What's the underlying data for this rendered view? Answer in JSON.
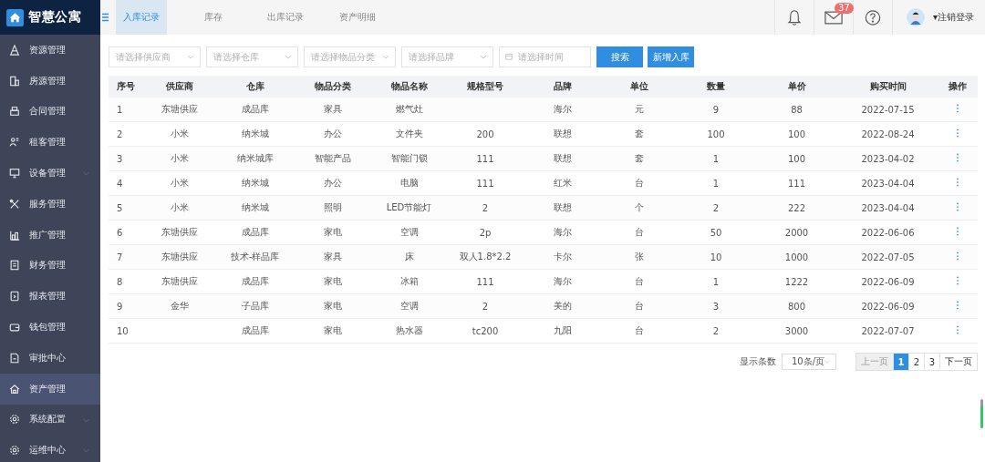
{
  "brand": "智慧公寓",
  "sidebar": {
    "items": [
      {
        "label": "资源管理",
        "selected": false,
        "has_submenu": false
      },
      {
        "label": "房源管理",
        "selected": false,
        "has_submenu": false
      },
      {
        "label": "合同管理",
        "selected": false,
        "has_submenu": false
      },
      {
        "label": "租客管理",
        "selected": false,
        "has_submenu": false
      },
      {
        "label": "设备管理",
        "selected": false,
        "has_submenu": true
      },
      {
        "label": "服务管理",
        "selected": false,
        "has_submenu": false
      },
      {
        "label": "推广管理",
        "selected": false,
        "has_submenu": false
      },
      {
        "label": "财务管理",
        "selected": false,
        "has_submenu": false
      },
      {
        "label": "报表管理",
        "selected": false,
        "has_submenu": false
      },
      {
        "label": "钱包管理",
        "selected": false,
        "has_submenu": false
      },
      {
        "label": "审批中心",
        "selected": false,
        "has_submenu": false
      },
      {
        "label": "资产管理",
        "selected": true,
        "has_submenu": false
      },
      {
        "label": "系统配置",
        "selected": false,
        "has_submenu": true
      },
      {
        "label": "运维中心",
        "selected": false,
        "has_submenu": true
      }
    ]
  },
  "tabs": [
    {
      "label": "入库记录",
      "selected": true
    },
    {
      "label": "库存",
      "selected": false
    },
    {
      "label": "出库记录",
      "selected": false
    },
    {
      "label": "资产明细",
      "selected": false
    }
  ],
  "header": {
    "mail_badge": "37",
    "logout": "▾注销登录"
  },
  "filters": [
    {
      "kind": "select",
      "placeholder": "请选择供应商"
    },
    {
      "kind": "select",
      "placeholder": "请选择仓库"
    },
    {
      "kind": "select",
      "placeholder": "请选择物品分类"
    },
    {
      "kind": "select",
      "placeholder": "请选择品牌"
    },
    {
      "kind": "date",
      "placeholder": "请选择时间"
    }
  ],
  "buttons": [
    "搜索",
    "新增入库"
  ],
  "table": {
    "columns": [
      "序号",
      "供应商",
      "仓库",
      "物品分类",
      "物品名称",
      "规格型号",
      "品牌",
      "单位",
      "数量",
      "单价",
      "购买时间",
      "操作"
    ],
    "rows": [
      [
        "1",
        "东塘供应",
        "成品库",
        "家具",
        "燃气灶",
        "",
        "海尔",
        "元",
        "9",
        "88",
        "2022-07-15"
      ],
      [
        "2",
        "小米",
        "纳米城",
        "办公",
        "文件夹",
        "200",
        "联想",
        "套",
        "100",
        "100",
        "2022-08-24"
      ],
      [
        "3",
        "小米",
        "纳米城库",
        "智能产品",
        "智能门锁",
        "111",
        "联想",
        "套",
        "1",
        "100",
        "2023-04-02"
      ],
      [
        "4",
        "小米",
        "纳米城",
        "办公",
        "电脑",
        "111",
        "红米",
        "台",
        "1",
        "111",
        "2023-04-04"
      ],
      [
        "5",
        "小米",
        "纳米城",
        "照明",
        "LED节能灯",
        "2",
        "联想",
        "个",
        "2",
        "222",
        "2023-04-04"
      ],
      [
        "6",
        "东塘供应",
        "成品库",
        "家电",
        "空调",
        "2p",
        "海尔",
        "台",
        "50",
        "2000",
        "2022-06-06"
      ],
      [
        "7",
        "东塘供应",
        "技术-样品库",
        "家具",
        "床",
        "双人1.8*2.2",
        "卡尔",
        "张",
        "10",
        "1000",
        "2022-07-05"
      ],
      [
        "8",
        "东塘供应",
        "成品库",
        "家电",
        "冰箱",
        "111",
        "海尔",
        "台",
        "1",
        "1222",
        "2022-06-09"
      ],
      [
        "9",
        "金华",
        "子品库",
        "家电",
        "空调",
        "2",
        "美的",
        "台",
        "3",
        "800",
        "2022-06-09"
      ],
      [
        "10",
        "",
        "成品库",
        "家电",
        "热水器",
        "tc200",
        "九阳",
        "台",
        "2",
        "3000",
        "2022-07-07"
      ]
    ]
  },
  "pagination": {
    "size_label": "显示条数",
    "page_size": "10条/页",
    "prev": "上一页",
    "next": "下一页",
    "pages": [
      {
        "label": "1",
        "selected": true
      },
      {
        "label": "2",
        "selected": false
      },
      {
        "label": "3",
        "selected": false
      }
    ]
  }
}
